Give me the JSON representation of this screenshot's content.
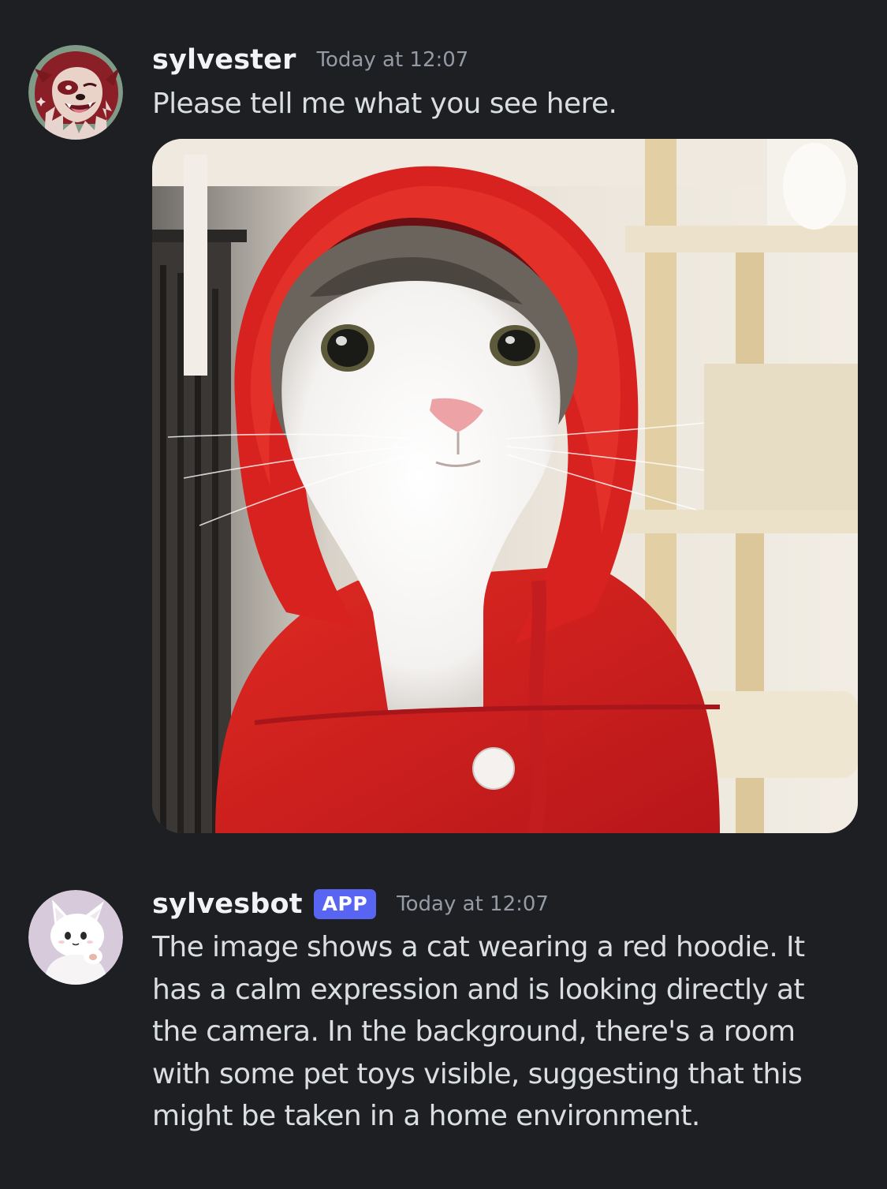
{
  "messages": [
    {
      "username": "sylvester",
      "timestamp": "Today at 12:07",
      "text": "Please tell me what you see here.",
      "avatar_icon": "wolf-avatar-icon",
      "attachment": "cat-in-red-hoodie-photo"
    },
    {
      "username": "sylvesbot",
      "badge": "APP",
      "timestamp": "Today at 12:07",
      "text_lines": [
        "The image shows a cat wearing a red hoodie. It",
        "has a calm expression and is looking directly at",
        "the camera. In the background, there's a room",
        "with some pet toys visible, suggesting that this",
        "might be taken in a home environment."
      ],
      "avatar_icon": "white-fox-avatar-icon"
    }
  ],
  "colors": {
    "background": "#1e1f22",
    "username": "#f2f3f5",
    "timestamp": "#949ba4",
    "message_text": "#dbdee1",
    "app_badge": "#5865f2"
  }
}
